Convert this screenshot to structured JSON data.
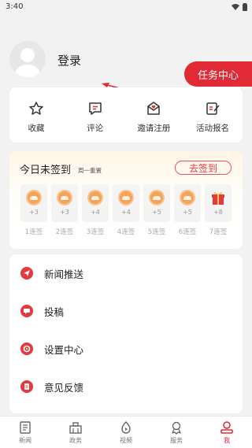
{
  "status_bar": {
    "time": "3:40"
  },
  "profile": {
    "login_label": "登录",
    "task_center_label": "任务中心"
  },
  "quick_actions": [
    {
      "label": "收藏",
      "icon": "star-icon"
    },
    {
      "label": "评论",
      "icon": "comment-icon"
    },
    {
      "label": "邀请注册",
      "icon": "invite-icon"
    },
    {
      "label": "活动报名",
      "icon": "signup-icon"
    }
  ],
  "sign_in": {
    "title": "今日未签到",
    "subtitle": "周一重置",
    "button_label": "去签到",
    "days": [
      {
        "points": "+3",
        "label": "1连签",
        "reward": "coin"
      },
      {
        "points": "+3",
        "label": "2连签",
        "reward": "coin"
      },
      {
        "points": "+4",
        "label": "3连签",
        "reward": "coin"
      },
      {
        "points": "+4",
        "label": "4连签",
        "reward": "coin"
      },
      {
        "points": "+5",
        "label": "5连签",
        "reward": "coin"
      },
      {
        "points": "+5",
        "label": "6连签",
        "reward": "coin"
      },
      {
        "points": "+8",
        "label": "7连签",
        "reward": "gift"
      }
    ]
  },
  "menu": [
    {
      "label": "新闻推送",
      "icon": "send-icon"
    },
    {
      "label": "投稿",
      "icon": "message-icon"
    },
    {
      "label": "设置中心",
      "icon": "settings-icon"
    },
    {
      "label": "意见反馈",
      "icon": "feedback-icon"
    }
  ],
  "tabs": [
    {
      "label": "新闻",
      "icon": "news-icon",
      "active": false
    },
    {
      "label": "政务",
      "icon": "government-icon",
      "active": false
    },
    {
      "label": "视频",
      "icon": "video-icon",
      "active": false
    },
    {
      "label": "服务",
      "icon": "service-icon",
      "active": false
    },
    {
      "label": "我",
      "icon": "profile-icon",
      "active": true
    }
  ],
  "colors": {
    "accent": "#e02a35",
    "coin": "#f4a35a",
    "gift": "#e43a3f"
  }
}
